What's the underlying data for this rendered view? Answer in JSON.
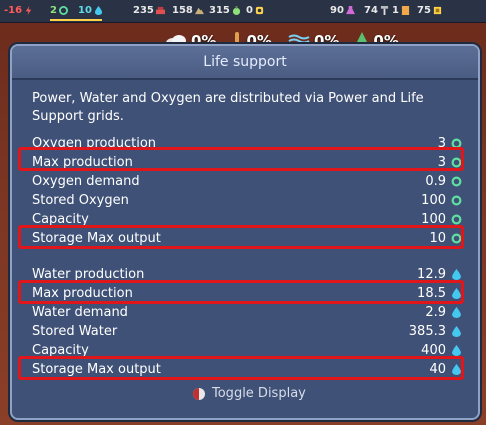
{
  "topbar": {
    "power": "-16",
    "oxygen": "2",
    "water": "10",
    "r1": "235",
    "r2": "158",
    "r3": "315",
    "r4": "0",
    "r5": "90",
    "r6": "74",
    "r7": "1",
    "r8": "75"
  },
  "env": {
    "cloud": "0%",
    "temp": "0%",
    "wind": "0%",
    "tree": "0%"
  },
  "panel": {
    "title": "Life support",
    "description": "Power, Water and Oxygen are distributed via Power and Life Support grids.",
    "oxygen_rows": [
      {
        "label": "Oxygen production",
        "value": "3"
      },
      {
        "label": "Max production",
        "value": "3"
      },
      {
        "label": "Oxygen demand",
        "value": "0.9"
      },
      {
        "label": "Stored Oxygen",
        "value": "100"
      },
      {
        "label": "Capacity",
        "value": "100"
      },
      {
        "label": "Storage Max output",
        "value": "10"
      }
    ],
    "water_rows": [
      {
        "label": "Water production",
        "value": "12.9"
      },
      {
        "label": "Max production",
        "value": "18.5"
      },
      {
        "label": "Water demand",
        "value": "2.9"
      },
      {
        "label": "Stored Water",
        "value": "385.3"
      },
      {
        "label": "Capacity",
        "value": "400"
      },
      {
        "label": "Storage Max output",
        "value": "40"
      }
    ],
    "toggle_label": "Toggle Display"
  },
  "colors": {
    "panel_bg": "#3f5176",
    "highlight": "#e0161b",
    "oxygen_icon": "#5fe0a0",
    "water_icon": "#45c8f0"
  }
}
